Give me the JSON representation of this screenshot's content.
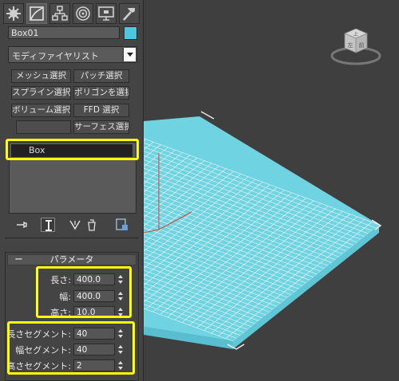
{
  "command_panel": {
    "tabs": [
      {
        "icon": "create-icon"
      },
      {
        "icon": "modify-icon",
        "active": true
      },
      {
        "icon": "hierarchy-icon"
      },
      {
        "icon": "motion-icon"
      },
      {
        "icon": "display-icon"
      },
      {
        "icon": "utilities-icon"
      }
    ],
    "object_name": "Box01",
    "object_color": "#4fc6e0",
    "modifier_list": "モディファイヤリスト",
    "selection_buttons": [
      "メッシュ選択",
      "パッチ選択",
      "スプライン選択",
      "ポリゴンを選択",
      "ボリューム選択",
      "FFD 選択",
      "",
      "サーフェス選択"
    ],
    "stack": {
      "items": [
        "Box"
      ]
    },
    "rollout": {
      "title": "パラメータ",
      "dimensions": [
        {
          "label": "長さ:",
          "value": "400.0"
        },
        {
          "label": "幅:",
          "value": "400.0"
        },
        {
          "label": "高さ:",
          "value": "10.0"
        }
      ],
      "segments": [
        {
          "label": "長さセグメント:",
          "value": "40"
        },
        {
          "label": "幅セグメント:",
          "value": "40"
        },
        {
          "label": "高さセグメント:",
          "value": "2"
        }
      ]
    }
  },
  "viewport": {
    "background": "#3f3f3f",
    "mesh_color": "#6fd3e2",
    "viewcube_labels": [
      "上",
      "左",
      "前"
    ]
  },
  "highlight_color": "#ffff00"
}
